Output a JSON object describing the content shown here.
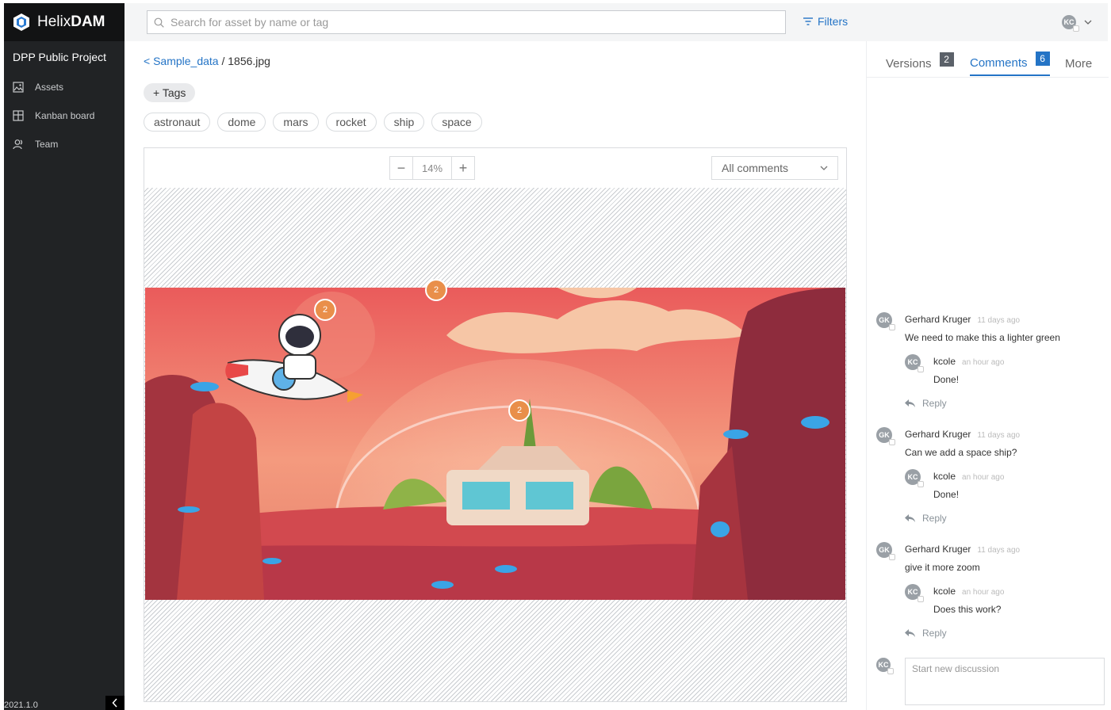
{
  "app": {
    "brand_light": "Helix",
    "brand_bold": "DAM",
    "version": "2021.1.0"
  },
  "sidebar": {
    "project": "DPP Public Project",
    "items": [
      {
        "label": "Assets",
        "icon": "image-icon"
      },
      {
        "label": "Kanban board",
        "icon": "board-icon"
      },
      {
        "label": "Team",
        "icon": "team-icon"
      }
    ]
  },
  "topbar": {
    "search_placeholder": "Search for asset by name or tag",
    "filters_label": "Filters",
    "user_initials": "KC"
  },
  "breadcrumb": {
    "parent": "< Sample_data",
    "separator": " / ",
    "current": "1856.jpg"
  },
  "tags": {
    "add_label": "+ Tags",
    "items": [
      "astronaut",
      "dome",
      "mars",
      "rocket",
      "ship",
      "space"
    ]
  },
  "viewer": {
    "zoom": "14%",
    "zoom_out": "−",
    "zoom_in": "+",
    "filter_selected": "All comments"
  },
  "pins": [
    "2",
    "2",
    "2"
  ],
  "panel": {
    "tabs": [
      {
        "label": "Versions",
        "count": "2"
      },
      {
        "label": "Comments",
        "count": "6"
      },
      {
        "label": "More",
        "count": ""
      }
    ],
    "threads": [
      {
        "author": "Gerhard Kruger",
        "author_initials": "GK",
        "time": "11 days ago",
        "text": "We need to make this a lighter green",
        "reply": {
          "author": "kcole",
          "author_initials": "KC",
          "time": "an hour ago",
          "text": "Done!"
        }
      },
      {
        "author": "Gerhard Kruger",
        "author_initials": "GK",
        "time": "11 days ago",
        "text": "Can we add a space ship?",
        "reply": {
          "author": "kcole",
          "author_initials": "KC",
          "time": "an hour ago",
          "text": "Done!"
        }
      },
      {
        "author": "Gerhard Kruger",
        "author_initials": "GK",
        "time": "11 days ago",
        "text": "give it more zoom",
        "reply": {
          "author": "kcole",
          "author_initials": "KC",
          "time": "an hour ago",
          "text": "Does this work?"
        }
      }
    ],
    "reply_label": "Reply",
    "new_discussion_placeholder": "Start new discussion",
    "current_user_initials": "KC"
  },
  "colors": {
    "accent": "#2474c6",
    "sidebar_bg": "#212325",
    "pin": "#e98f4a"
  }
}
